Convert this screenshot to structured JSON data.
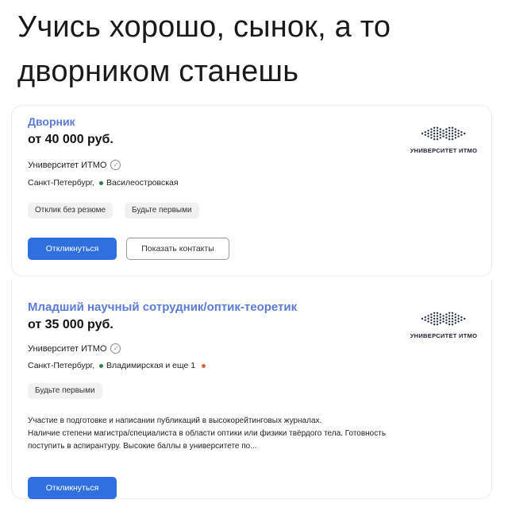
{
  "caption": {
    "line1": "Учись хорошо, сынок, а то",
    "line2": "дворником станешь"
  },
  "vacancies": [
    {
      "title": "Дворник",
      "salary": "от 40 000 руб.",
      "employer": "Университет ИТМО",
      "city": "Санкт-Петербург,",
      "metro": "Василеостровская",
      "tags": [
        "Отклик без резюме",
        "Будьте первыми"
      ],
      "apply_label": "Откликнуться",
      "contacts_label": "Показать контакты",
      "logo_text": "УНИВЕРСИТЕТ ИТМО"
    },
    {
      "title": "Младший научный сотрудник/оптик-теоретик",
      "salary": "от 35 000 руб.",
      "employer": "Университет ИТМО",
      "city": "Санкт-Петербург,",
      "metro": "Владимирская и еще 1",
      "tags": [
        "Будьте первыми"
      ],
      "description": [
        "Участие в подготовке и написании публикаций в высокорейтинговых журналах.",
        "Наличие степени магистра/специалиста в области оптики или физики твёрдого тела. Готовность",
        "поступить в аспирантуру. Высокие баллы в университете по..."
      ],
      "apply_label": "Откликнуться",
      "logo_text": "УНИВЕРСИТЕТ ИТМО"
    }
  ],
  "colors": {
    "title_blue": "#5c7bd6",
    "button_blue": "#2f6fe0",
    "metro_green": "#2f7d4a"
  },
  "icons": {
    "verified": "verified-check-icon",
    "logo": "itmo-dots-logo"
  }
}
